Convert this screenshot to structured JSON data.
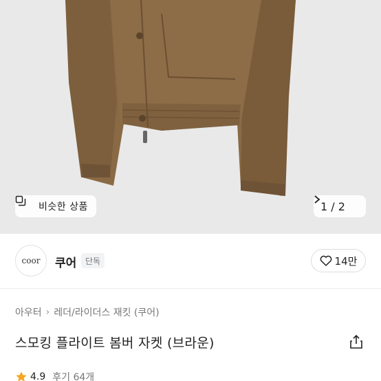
{
  "gallery": {
    "similar_label": "비슷한 상품",
    "pager_text": "1 / 2"
  },
  "brand": {
    "logo_text": "coor",
    "name": "쿠어",
    "badge": "단독",
    "likes": "14만"
  },
  "product": {
    "breadcrumb": [
      "아우터",
      "레더/라이더스 재킷 (쿠어)"
    ],
    "title": "스모킹 플라이트 봄버 자켓 (브라운)",
    "rating": "4.9",
    "review_label": "후기 64개"
  },
  "colors": {
    "jacket": "#8a6a45",
    "star": "#f5a623"
  },
  "icons": {
    "similar": "copy-icon",
    "next": "chevron-right-icon",
    "like": "heart-icon",
    "share": "share-icon",
    "rating": "star-icon"
  }
}
